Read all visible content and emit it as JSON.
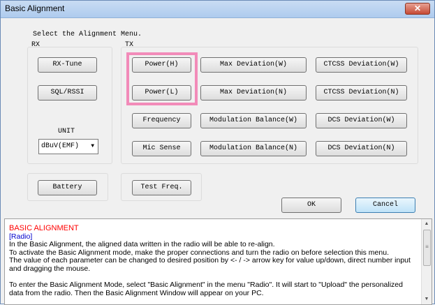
{
  "window": {
    "title": "Basic Alignment",
    "close_glyph": "✕"
  },
  "header": {
    "prompt": "Select the Alignment Menu."
  },
  "rx": {
    "label": "RX",
    "rx_tune": "RX-Tune",
    "sql_rssi": "SQL/RSSI",
    "unit_label": "UNIT",
    "unit_value": "dBuV(EMF)",
    "battery": "Battery"
  },
  "tx": {
    "label": "TX",
    "power_h": "Power(H)",
    "power_l": "Power(L)",
    "frequency": "Frequency",
    "mic_sense": "Mic Sense",
    "max_dev_w": "Max Deviation(W)",
    "max_dev_n": "Max Deviation(N)",
    "mod_bal_w": "Modulation Balance(W)",
    "mod_bal_n": "Modulation Balance(N)",
    "ctcss_w": "CTCSS Deviation(W)",
    "ctcss_n": "CTCSS Deviation(N)",
    "dcs_w": "DCS Deviation(W)",
    "dcs_n": "DCS Deviation(N)",
    "test_freq": "Test Freq."
  },
  "actions": {
    "ok": "OK",
    "cancel": "Cancel"
  },
  "help": {
    "heading": "BASIC ALIGNMENT",
    "subheading": "[Radio]",
    "lines": [
      "In the Basic Alignment, the aligned data written in the radio will be able to re-align.",
      "To activate the Basic Alignment mode, make the proper connections and turn the radio on before selection this menu.",
      "The value of each parameter can be changed to desired position by <- / -> arrow key for value up/down, direct number input",
      "and dragging the mouse.",
      "",
      "To enter the Basic Alignment Mode, select \"Basic Alignment\" in the menu \"Radio\". It will start to \"Upload\" the personalized",
      "data from the radio. Then the Basic Alignment Window will appear on your PC."
    ]
  },
  "colors": {
    "heading": "#ff0000",
    "subheading": "#0000cc",
    "highlight": "#f28bb9"
  },
  "icons": {
    "dropdown": "chevron-down-icon",
    "scroll_up": "scroll-up-icon",
    "scroll_down": "scroll-down-icon"
  }
}
